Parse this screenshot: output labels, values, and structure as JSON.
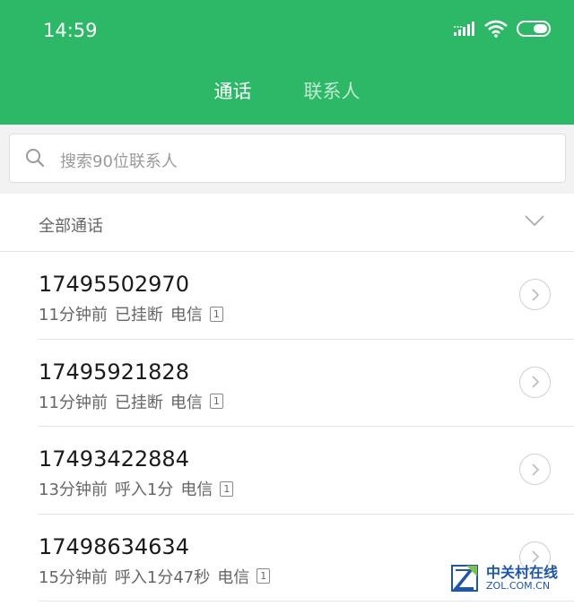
{
  "status_bar": {
    "time": "14:59"
  },
  "tabs": [
    {
      "label": "通话",
      "active": true
    },
    {
      "label": "联系人",
      "active": false
    }
  ],
  "search": {
    "placeholder": "搜索90位联系人"
  },
  "filter": {
    "label": "全部通话"
  },
  "calls": [
    {
      "number": "17495502970",
      "time_ago": "11分钟前",
      "status": "已挂断",
      "carrier": "电信",
      "sim": "1"
    },
    {
      "number": "17495921828",
      "time_ago": "11分钟前",
      "status": "已挂断",
      "carrier": "电信",
      "sim": "1"
    },
    {
      "number": "17493422884",
      "time_ago": "13分钟前",
      "status": "呼入1分",
      "carrier": "电信",
      "sim": "1"
    },
    {
      "number": "17498634634",
      "time_ago": "15分钟前",
      "status": "呼入1分47秒",
      "carrier": "电信",
      "sim": "1"
    }
  ],
  "watermark": {
    "name": "中关村在线",
    "domain": "ZOL.COM.CN"
  },
  "colors": {
    "header": "#2cb866",
    "watermark": "#1f56a8"
  }
}
